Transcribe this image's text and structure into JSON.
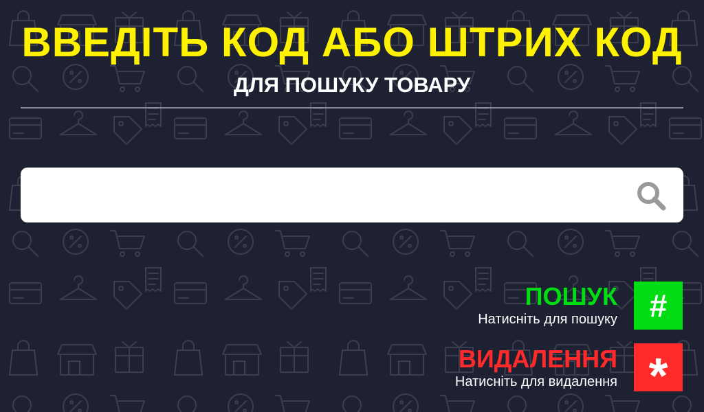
{
  "header": {
    "title": "ВВЕДІТЬ КОД АБО ШТРИХ КОД",
    "subtitle": "ДЛЯ ПОШУКУ ТОВАРУ"
  },
  "search": {
    "value": "",
    "placeholder": "",
    "icon": "search-icon"
  },
  "actions": {
    "search": {
      "title": "ПОШУК",
      "description": "Натисніть для пошуку",
      "key": "#",
      "color": "#00dd12"
    },
    "delete": {
      "title": "ВИДАЛЕННЯ",
      "description": "Натисніть для видалення",
      "key": "*",
      "color": "#ff2b2b"
    }
  },
  "colors": {
    "background": "#1d2132",
    "title": "#fff200",
    "search_icon": "#9a9a9a"
  }
}
